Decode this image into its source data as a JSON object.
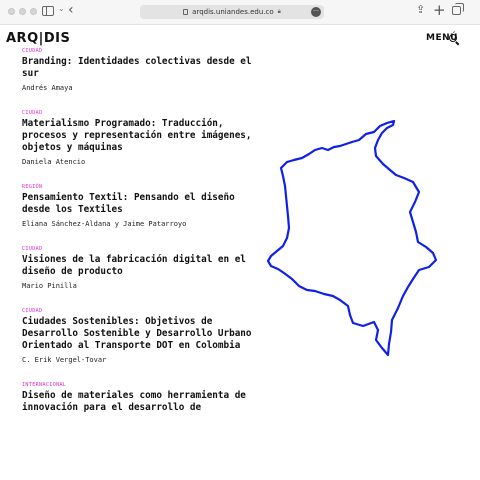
{
  "browser": {
    "url": "arqdis.uniandes.edu.co"
  },
  "site": {
    "logo": "ARQ|DIS",
    "menu_label": "MENÚ"
  },
  "articles": [
    {
      "category": "CIUDAD",
      "title": "Branding: Identidades colectivas desde el sur",
      "author": "Andrés Amaya"
    },
    {
      "category": "CIUDAD",
      "title": "Materialismo Programado: Traducción, procesos y representación entre imágenes, objetos y máquinas",
      "author": "Daniela Atencio"
    },
    {
      "category": "REGIÓN",
      "title": "Pensamiento Textil: Pensando el diseño desde los Textiles",
      "author": "Eliana Sánchez-Aldana y Jaime Patarroyo"
    },
    {
      "category": "CIUDAD",
      "title": "Visiones de la fabricación digital en el diseño de producto",
      "author": "Mario Pinilla"
    },
    {
      "category": "CIUDAD",
      "title": "Ciudades Sostenibles: Objetivos de Desarrollo Sostenible y Desarrollo Urbano Orientado al Transporte DOT en Colombia",
      "author": "C. Erik Vergel-Tovar"
    },
    {
      "category": "INTERNACIONAL",
      "title": "Diseño de materiales como herramienta de innovación para el desarrollo de",
      "author": ""
    }
  ],
  "colors": {
    "accent": "#e028d6",
    "map_outline": "#1020e8"
  },
  "icons": {
    "map": "colombia-map-outline",
    "search": "search-icon"
  }
}
